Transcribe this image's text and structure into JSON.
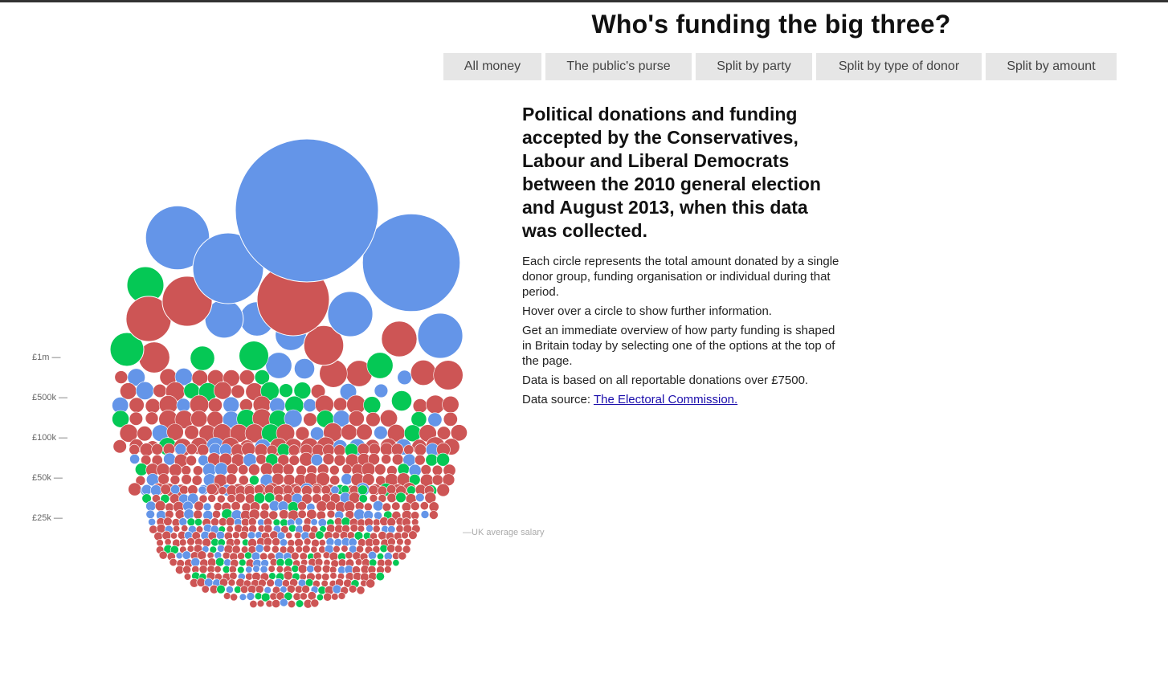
{
  "page": {
    "title": "Who's funding the big three?"
  },
  "nav": {
    "buttons": [
      {
        "label": "All money"
      },
      {
        "label": "The public's purse"
      },
      {
        "label": "Split by party"
      },
      {
        "label": "Split by type of donor"
      },
      {
        "label": "Split by amount"
      }
    ]
  },
  "info": {
    "heading": "Political donations and funding accepted by the Conservatives, Labour and Liberal Democrats between the 2010 general election and August 2013, when this data was collected.",
    "paragraphs": [
      "Each circle represents the total amount donated by a single donor group, funding organisation or individual during that period.",
      "Hover over a circle to show further information.",
      "Get an immediate overview of how party funding is shaped in Britain today by selecting one of the options at the top of the page.",
      "Data is based on all reportable donations over £7500."
    ],
    "source_prefix": "Data source: ",
    "source_link": "The Electoral Commission."
  },
  "colors": {
    "conservative": "#6495e8",
    "labour": "#cd5555",
    "libdem": "#05c855"
  },
  "chart_data": {
    "type": "bubble",
    "scale_labels": [
      "£1m —",
      "£500k —",
      "£100k —",
      "£50k —",
      "£25k —"
    ],
    "annotation": "—UK average salary",
    "series": [
      {
        "party": "conservative",
        "large": [
          9000000,
          4200000,
          2200000,
          1800000,
          900000,
          900000,
          650000,
          520000,
          420000,
          300000,
          180000
        ]
      },
      {
        "party": "labour",
        "large": [
          2300000,
          1100000,
          900000,
          700000,
          560000,
          420000,
          380000,
          340000,
          300000,
          280000
        ]
      },
      {
        "party": "libdem",
        "large": [
          600000,
          500000,
          380000,
          300000,
          260000,
          180000
        ]
      }
    ]
  }
}
